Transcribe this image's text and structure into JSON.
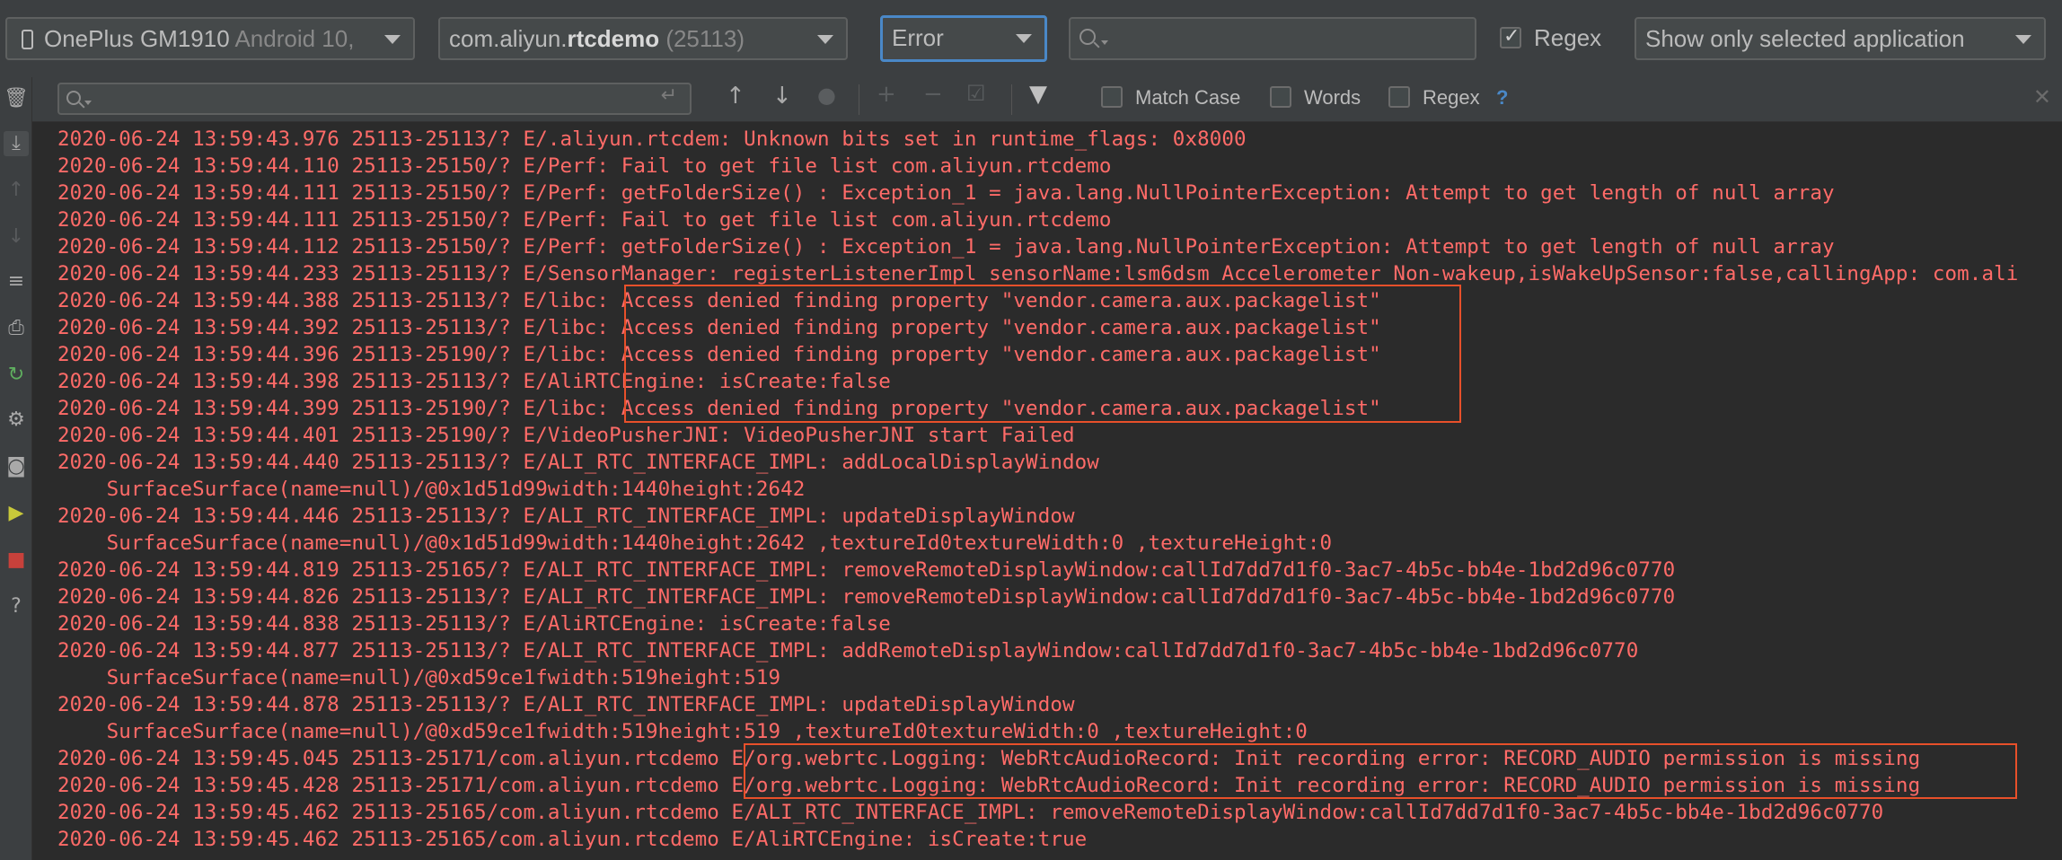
{
  "toolbar": {
    "device_name": "OnePlus GM1910",
    "device_os": "Android 10,",
    "app_prefix": "com.aliyun.",
    "app_bold": "rtcdemo",
    "app_pid": "(25113)",
    "log_level": "Error",
    "search_placeholder": "",
    "regex_label": "Regex",
    "regex_checked": true,
    "filter_mode": "Show only selected application"
  },
  "search_bar": {
    "query": "",
    "match_case_label": "Match Case",
    "words_label": "Words",
    "regex_label": "Regex",
    "help": "?"
  },
  "colors": {
    "error_text": "#ff6b68",
    "highlight_box": "#e8502a",
    "background": "#2b2b2b",
    "toolbar": "#3c3f41",
    "focus": "#4a88c7"
  },
  "log_lines": [
    "2020-06-24 13:59:43.976 25113-25113/? E/.aliyun.rtcdem: Unknown bits set in runtime_flags: 0x8000",
    "2020-06-24 13:59:44.110 25113-25150/? E/Perf: Fail to get file list com.aliyun.rtcdemo",
    "2020-06-24 13:59:44.111 25113-25150/? E/Perf: getFolderSize() : Exception_1 = java.lang.NullPointerException: Attempt to get length of null array",
    "2020-06-24 13:59:44.111 25113-25150/? E/Perf: Fail to get file list com.aliyun.rtcdemo",
    "2020-06-24 13:59:44.112 25113-25150/? E/Perf: getFolderSize() : Exception_1 = java.lang.NullPointerException: Attempt to get length of null array",
    "2020-06-24 13:59:44.233 25113-25113/? E/SensorManager: registerListenerImpl sensorName:lsm6dsm Accelerometer Non-wakeup,isWakeUpSensor:false,callingApp: com.ali",
    "2020-06-24 13:59:44.388 25113-25113/? E/libc: Access denied finding property \"vendor.camera.aux.packagelist\"",
    "2020-06-24 13:59:44.392 25113-25113/? E/libc: Access denied finding property \"vendor.camera.aux.packagelist\"",
    "2020-06-24 13:59:44.396 25113-25190/? E/libc: Access denied finding property \"vendor.camera.aux.packagelist\"",
    "2020-06-24 13:59:44.398 25113-25113/? E/AliRTCEngine: isCreate:false",
    "2020-06-24 13:59:44.399 25113-25190/? E/libc: Access denied finding property \"vendor.camera.aux.packagelist\"",
    "2020-06-24 13:59:44.401 25113-25190/? E/VideoPusherJNI: VideoPusherJNI start Failed",
    "2020-06-24 13:59:44.440 25113-25113/? E/ALI_RTC_INTERFACE_IMPL: addLocalDisplayWindow",
    "    SurfaceSurface(name=null)/@0x1d51d99width:1440height:2642",
    "2020-06-24 13:59:44.446 25113-25113/? E/ALI_RTC_INTERFACE_IMPL: updateDisplayWindow",
    "    SurfaceSurface(name=null)/@0x1d51d99width:1440height:2642 ,textureId0textureWidth:0 ,textureHeight:0",
    "2020-06-24 13:59:44.819 25113-25165/? E/ALI_RTC_INTERFACE_IMPL: removeRemoteDisplayWindow:callId7dd7d1f0-3ac7-4b5c-bb4e-1bd2d96c0770",
    "2020-06-24 13:59:44.826 25113-25113/? E/ALI_RTC_INTERFACE_IMPL: removeRemoteDisplayWindow:callId7dd7d1f0-3ac7-4b5c-bb4e-1bd2d96c0770",
    "2020-06-24 13:59:44.838 25113-25113/? E/AliRTCEngine: isCreate:false",
    "2020-06-24 13:59:44.877 25113-25113/? E/ALI_RTC_INTERFACE_IMPL: addRemoteDisplayWindow:callId7dd7d1f0-3ac7-4b5c-bb4e-1bd2d96c0770",
    "    SurfaceSurface(name=null)/@0xd59ce1fwidth:519height:519",
    "2020-06-24 13:59:44.878 25113-25113/? E/ALI_RTC_INTERFACE_IMPL: updateDisplayWindow",
    "    SurfaceSurface(name=null)/@0xd59ce1fwidth:519height:519 ,textureId0textureWidth:0 ,textureHeight:0",
    "2020-06-24 13:59:45.045 25113-25171/com.aliyun.rtcdemo E/org.webrtc.Logging: WebRtcAudioRecord: Init recording error: RECORD_AUDIO permission is missing",
    "2020-06-24 13:59:45.428 25113-25171/com.aliyun.rtcdemo E/org.webrtc.Logging: WebRtcAudioRecord: Init recording error: RECORD_AUDIO permission is missing",
    "2020-06-24 13:59:45.462 25113-25165/com.aliyun.rtcdemo E/ALI_RTC_INTERFACE_IMPL: removeRemoteDisplayWindow:callId7dd7d1f0-3ac7-4b5c-bb4e-1bd2d96c0770",
    "2020-06-24 13:59:45.462 25113-25165/com.aliyun.rtcdemo E/AliRTCEngine: isCreate:true"
  ]
}
